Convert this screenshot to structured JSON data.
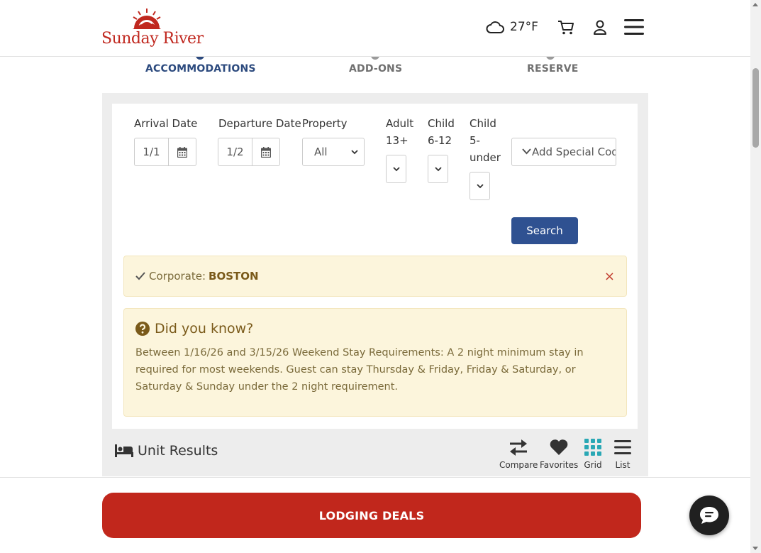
{
  "header": {
    "logo_text": "Sunday River",
    "weather": {
      "icon": "cloud-icon",
      "temp": "27°F"
    },
    "icons": [
      "cart-icon",
      "user-icon",
      "hamburger-menu-icon"
    ]
  },
  "steps": [
    {
      "label": "ACCOMMODATIONS",
      "state": "active"
    },
    {
      "label": "ADD-ONS",
      "state": "inactive"
    },
    {
      "label": "RESERVE",
      "state": "inactive"
    }
  ],
  "search": {
    "arrival_label": "Arrival Date",
    "arrival_value": "1/1",
    "departure_label": "Departure Date",
    "departure_value": "1/2",
    "property_label": "Property",
    "property_value": "All",
    "adult_label_1": "Adult",
    "adult_label_2": "13+",
    "child1_label_1": "Child",
    "child1_label_2": "6-12",
    "child2_label_1": "Child",
    "child2_label_2": "5-",
    "child2_label_3": "under",
    "special_code_label": "Add Special Code",
    "search_button": "Search"
  },
  "corporate": {
    "prefix": "Corporate:",
    "code": "BOSTON",
    "close_glyph": "×"
  },
  "did_you_know": {
    "title": "Did you know?",
    "body": "Between 1/16/26 and 3/15/26 Weekend Stay Requirements: A 2 night minimum stay in required for most weekends. Guest can stay Thursday & Friday, Friday & Saturday, or Saturday & Sunday under the 2 night requirement."
  },
  "results": {
    "title": "Unit Results",
    "tools": [
      {
        "label": "Compare",
        "icon": "compare-arrows-icon"
      },
      {
        "label": "Favorites",
        "icon": "heart-icon"
      },
      {
        "label": "Grid",
        "icon": "grid-icon"
      },
      {
        "label": "List",
        "icon": "list-icon"
      }
    ]
  },
  "deals_button": "LODGING DEALS",
  "colors": {
    "brand_red": "#c1271c",
    "primary_blue": "#2f5191",
    "step_active": "#2c4a7e",
    "alert_bg": "#fcf5dc",
    "grid_teal": "#2aa8b5"
  }
}
